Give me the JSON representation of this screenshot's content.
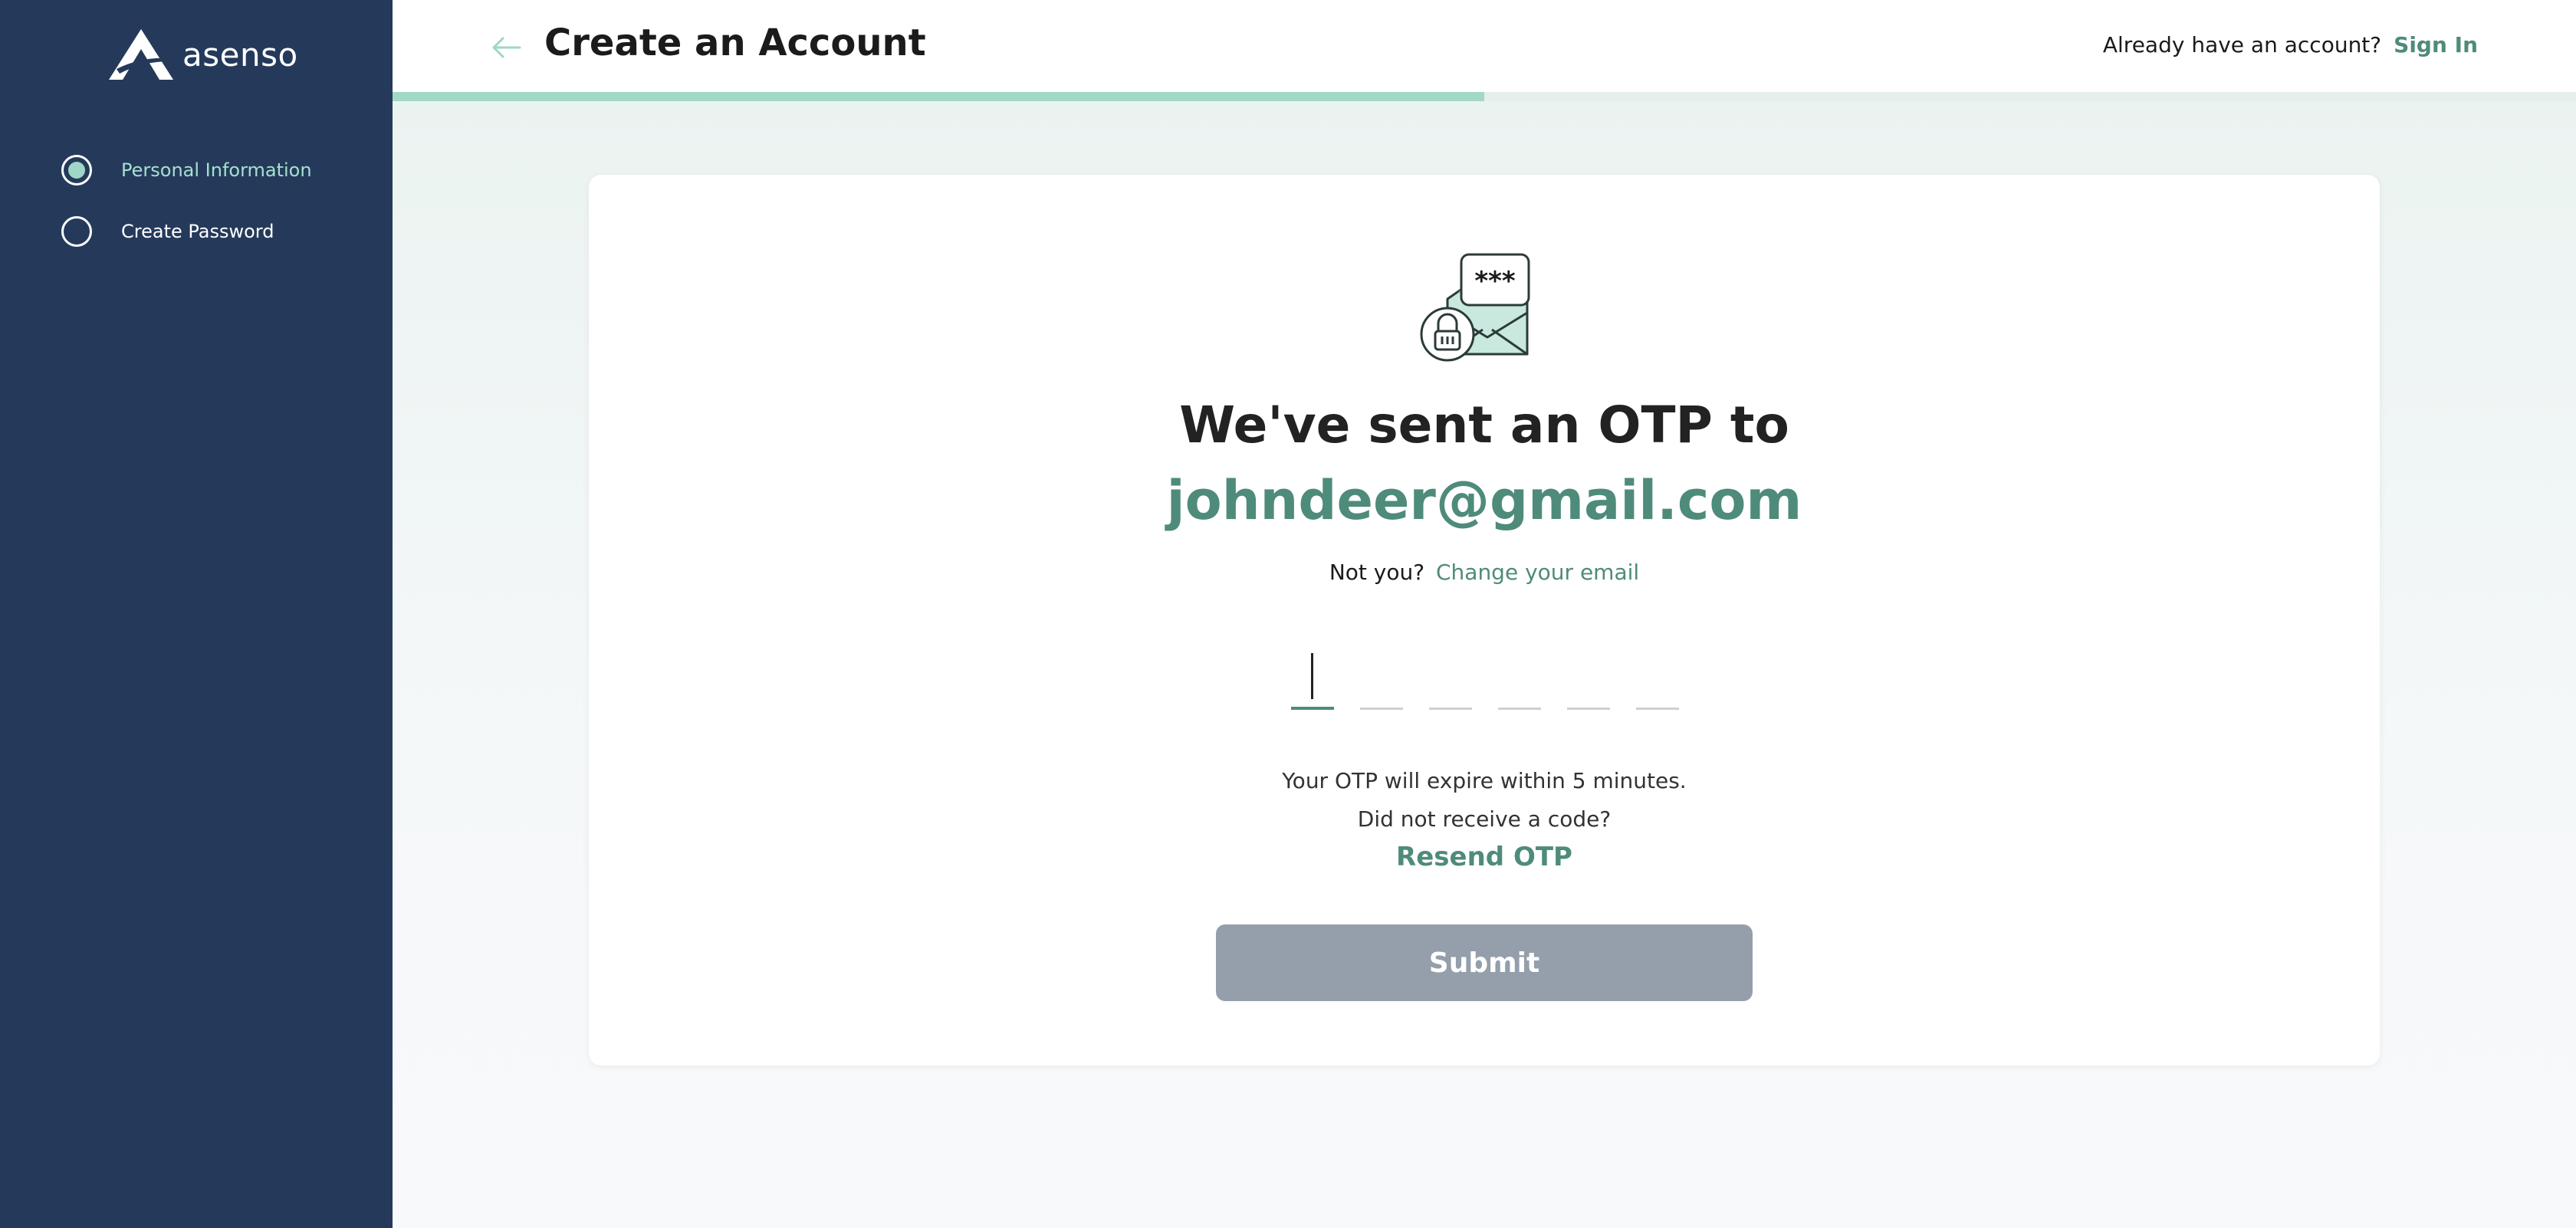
{
  "sidebar": {
    "logo_text": "asenso",
    "steps": [
      {
        "label": "Personal Information",
        "active": true
      },
      {
        "label": "Create Password",
        "active": false
      }
    ]
  },
  "header": {
    "title": "Create an Account",
    "already_text": "Already have an account?",
    "signin_label": "Sign In",
    "progress_percent": 50
  },
  "card": {
    "illustration_text": "***",
    "heading": "We've sent an OTP to",
    "email": "johndeer@gmail.com",
    "not_you": "Not you?",
    "change_email": "Change your email",
    "otp_digits": [
      "",
      "",
      "",
      "",
      "",
      ""
    ],
    "expiry_text": "Your OTP will expire within 5 minutes.",
    "no_receive_text": "Did not receive a code?",
    "resend_label": "Resend OTP",
    "submit_label": "Submit"
  },
  "colors": {
    "sidebar_bg": "#253a5b",
    "accent": "#4e8b7b",
    "accent_light": "#a3d8c8",
    "submit_disabled": "#949fab"
  }
}
